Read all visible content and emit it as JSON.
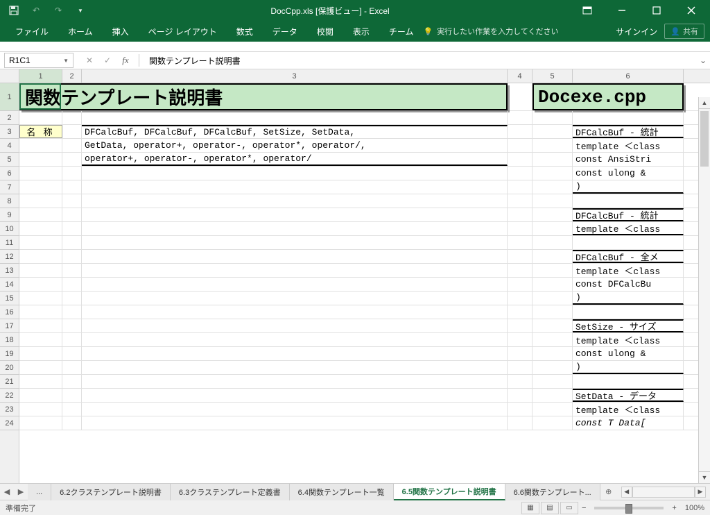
{
  "titlebar": {
    "title": "DocCpp.xls [保護ビュー] - Excel"
  },
  "ribbon": {
    "file": "ファイル",
    "home": "ホーム",
    "insert": "挿入",
    "pagelayout": "ページ レイアウト",
    "formulas": "数式",
    "data": "データ",
    "review": "校閲",
    "view": "表示",
    "team": "チーム",
    "tellme": "実行したい作業を入力してください",
    "signin": "サインイン",
    "share": "共有"
  },
  "formula": {
    "namebox": "R1C1",
    "content": "関数テンプレート説明書"
  },
  "columns": [
    "1",
    "2",
    "3",
    "4",
    "5",
    "6"
  ],
  "rows": [
    "1",
    "2",
    "3",
    "4",
    "5",
    "6",
    "7",
    "8",
    "9",
    "10",
    "11",
    "12",
    "13",
    "14",
    "15",
    "16",
    "17",
    "18",
    "19",
    "20",
    "21",
    "22",
    "23",
    "24"
  ],
  "cells": {
    "title_left": "関数テンプレート説明書",
    "title_right": "Docexe.cpp",
    "name_label": "名 称",
    "r3c3": "DFCalcBuf, DFCalcBuf, DFCalcBuf, SetSize, SetData,",
    "r4c3": "GetData, operator+, operator-, operator*, operator/,",
    "r5c3": "operator+, operator-, operator*, operator/",
    "r3c6": "DFCalcBuf - 統計",
    "r4c6": "template ＜class",
    "r5c6": "  const AnsiStri",
    "r6c6": "  const ulong &",
    "r7c6": ")",
    "r9c6": "DFCalcBuf - 統計",
    "r10c6": "template ＜class",
    "r12c6": "DFCalcBuf - 全メ",
    "r13c6": "template ＜class",
    "r14c6": "  const DFCalcBu",
    "r15c6": ")",
    "r17c6": "SetSize - サイズ",
    "r18c6": "template ＜class",
    "r19c6": "  const ulong &",
    "r20c6": ")",
    "r22c6": "SetData - データ",
    "r23c6": "template ＜class",
    "r24c6": "  const T  Data["
  },
  "tabs": {
    "ellipsis": "...",
    "t1": "6.2クラステンプレート説明書",
    "t2": "6.3クラステンプレート定義書",
    "t3": "6.4関数テンプレート一覧",
    "t4": "6.5関数テンプレート説明書",
    "t5": "6.6関数テンプレート..."
  },
  "status": {
    "ready": "準備完了",
    "zoom": "100%"
  },
  "chart_data": null
}
